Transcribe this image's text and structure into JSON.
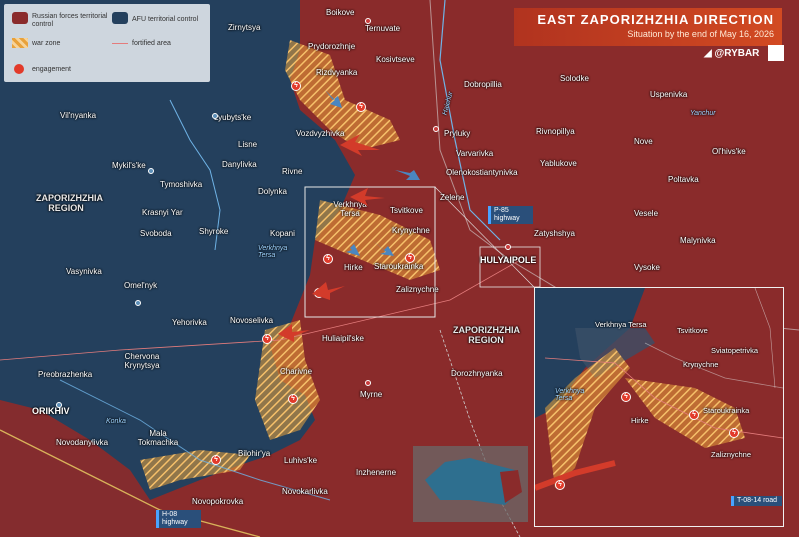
{
  "header": {
    "title": "EAST ZAPORIZHZHIA DIRECTION",
    "subtitle": "Situation by the end of May 16, 2026",
    "brand": "@RYBAR"
  },
  "legend": {
    "russian": "Russian forces territorial control",
    "afu": "AFU territorial control",
    "warzone": "war zone",
    "fortified": "fortified area",
    "engagement": "engagement"
  },
  "colors": {
    "russian": "#8a2b2b",
    "afu": "#24405d",
    "warzone": "#e8a13a",
    "engagement": "#e23a2a",
    "title_bg": "#c23a20"
  },
  "icons": {
    "russian_marker": "red-hexagon-icon",
    "afu_marker": "blue-hexagon-icon",
    "engagement_marker": "flash-circle-icon",
    "attack_arrow": "red-arrow-icon",
    "counter_arrow": "blue-arrow-icon",
    "telegram": "telegram-icon",
    "qr": "qr-code-icon"
  },
  "regions": {
    "west": "ZAPORIZHZHIA REGION",
    "east": "ZAPORIZHZHIA REGION",
    "inset_note": "Verkhnya Tersa"
  },
  "rivers": {
    "haichur": "Haichur",
    "yanchur": "Yanchur",
    "konka": "Konka",
    "verkhnya_tersa_1": "Verkhnya Tersa",
    "verkhnya_tersa_2": "Verkhnya Tersa"
  },
  "highways": {
    "p85": "P-85 highway",
    "h08": "H-08 highway",
    "t0814": "T-08-14 road"
  },
  "settlements": [
    "Boikove",
    "Zirnytsya",
    "Ternuvate",
    "Prydorozhnje",
    "Kosivtseve",
    "Rizdvyanka",
    "Dobropillia",
    "Solodke",
    "Uspenivka",
    "Vil'nyanka",
    "Lyubyts'ke",
    "Vozdvyzhivka",
    "Pryluky",
    "Rivnopillya",
    "Nove",
    "Lisne",
    "Varvarivka",
    "Danylivka",
    "Yablukove",
    "Olenokostiantynivka",
    "Ol'hivs'ke",
    "Mykil's'ke",
    "Rivne",
    "Tymoshivka",
    "Poltavka",
    "Dolynka",
    "Zelene",
    "Krasnyi Yar",
    "Verkhnya Tersa",
    "Tsvitkove",
    "Svoboda",
    "Shyroke",
    "Kopani",
    "Vesele",
    "Krynychne",
    "Zatyshshya",
    "Malynivka",
    "Hirke",
    "Staroukrainka",
    "HULYAIPOLE",
    "Vasynivka",
    "Vysoke",
    "Zaliznychne",
    "Omel'nyk",
    "Novoselivka",
    "Yehorivka",
    "Huliaipil'ske",
    "Chervona Krynytsya",
    "Preobrazhenka",
    "Dorozhnyanka",
    "Charivne",
    "ORIKHIV",
    "Myrne",
    "Mala Tokmachka",
    "Novodanylivka",
    "Bilohir'ya",
    "Luhivs'ke",
    "Inzhenerne",
    "Novokarlivka",
    "Novopokrovka"
  ],
  "inset_settlements": [
    "Verkhnya Tersa",
    "Tsvitkove",
    "Sviatopetrivka",
    "Krynychne",
    "Hirke",
    "Staroukrainka",
    "Zaliznychne"
  ]
}
